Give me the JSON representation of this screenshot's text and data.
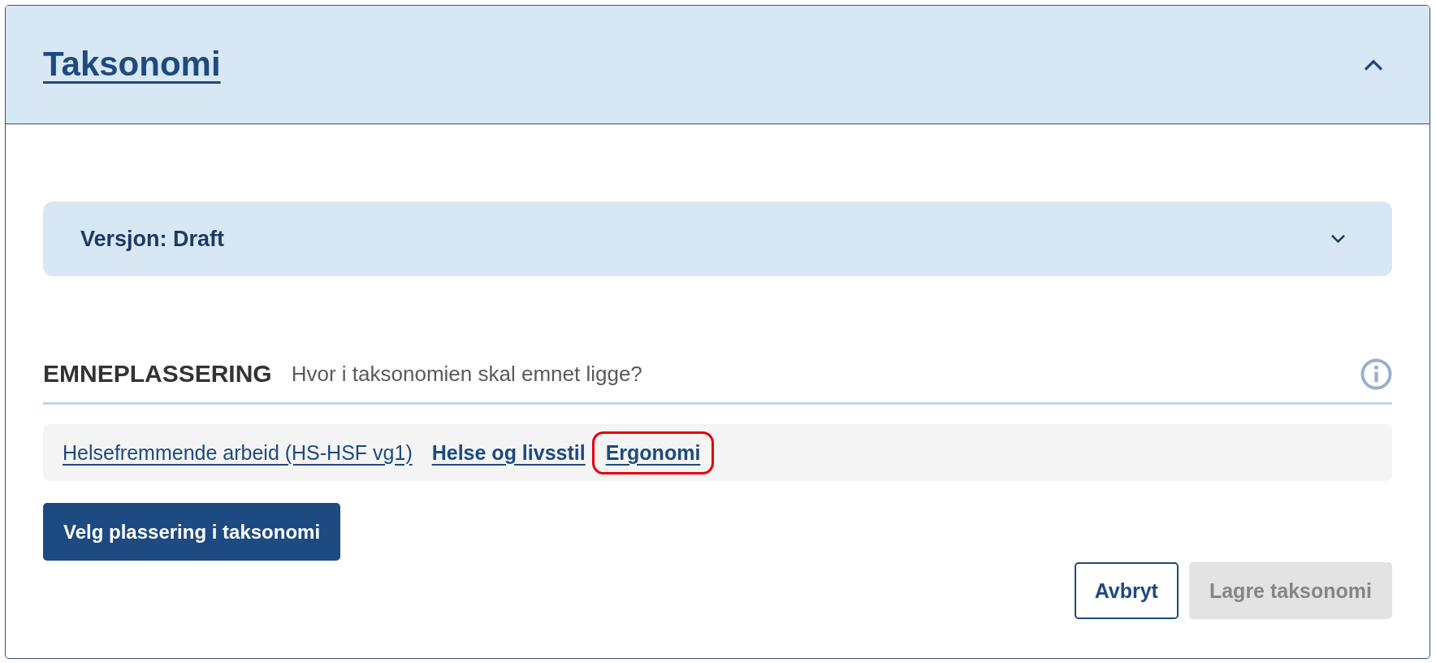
{
  "panel": {
    "title": "Taksonomi",
    "expanded": true
  },
  "version": {
    "label": "Versjon: Draft",
    "expanded": false
  },
  "placement": {
    "heading": "EMNEPLASSERING",
    "subtitle": "Hvor i taksonomien skal emnet ligge?"
  },
  "breadcrumbs": [
    {
      "label": "Helsefremmende arbeid (HS-HSF vg1)",
      "kind": "subject",
      "highlighted": false
    },
    {
      "label": "Helse og livsstil",
      "kind": "topic",
      "highlighted": false
    },
    {
      "label": "Ergonomi",
      "kind": "topic",
      "highlighted": true
    }
  ],
  "choose_button": {
    "label": "Velg plassering i taksonomi",
    "disabled": false
  },
  "actions": [
    {
      "label": "Avbryt",
      "kind": "secondary",
      "disabled": false
    },
    {
      "label": "Lagre taksonomi",
      "kind": "primary",
      "disabled": true
    }
  ]
}
